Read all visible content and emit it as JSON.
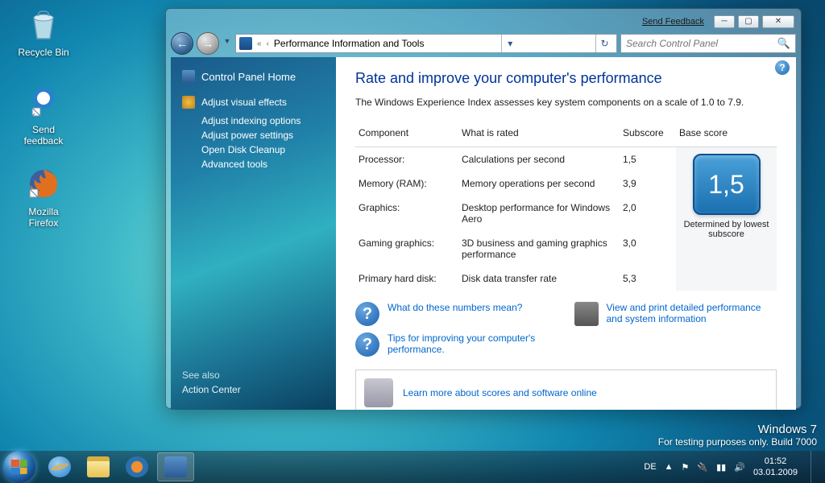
{
  "desktop": {
    "icons": [
      {
        "name": "recycle-bin",
        "label": "Recycle Bin"
      },
      {
        "name": "send-feedback",
        "label": "Send feedback"
      },
      {
        "name": "firefox",
        "label": "Mozilla Firefox"
      }
    ]
  },
  "window": {
    "send_feedback": "Send Feedback",
    "breadcrumb": {
      "chev1": "«",
      "chev2": "‹",
      "title": "Performance Information and Tools"
    },
    "search_placeholder": "Search Control Panel",
    "sidebar": {
      "home": "Control Panel Home",
      "adjust_visual": "Adjust visual effects",
      "subs": [
        "Adjust indexing options",
        "Adjust power settings",
        "Open Disk Cleanup",
        "Advanced tools"
      ],
      "see_also_hdr": "See also",
      "see_also_item": "Action Center"
    },
    "main": {
      "heading": "Rate and improve your computer's performance",
      "intro": "The Windows Experience Index assesses key system components on a scale of 1.0 to 7.9.",
      "cols": {
        "component": "Component",
        "rated": "What is rated",
        "sub": "Subscore",
        "base": "Base score"
      },
      "rows": [
        {
          "c": "Processor:",
          "r": "Calculations per second",
          "s": "1,5"
        },
        {
          "c": "Memory (RAM):",
          "r": "Memory operations per second",
          "s": "3,9"
        },
        {
          "c": "Graphics:",
          "r": "Desktop performance for Windows Aero",
          "s": "2,0"
        },
        {
          "c": "Gaming graphics:",
          "r": "3D business and gaming graphics performance",
          "s": "3,0"
        },
        {
          "c": "Primary hard disk:",
          "r": "Disk data transfer rate",
          "s": "5,3"
        }
      ],
      "base_score": "1,5",
      "base_caption": "Determined by lowest subscore",
      "link_numbers": "What do these numbers mean?",
      "link_tips": "Tips for improving your computer's performance.",
      "link_print": "View and print detailed performance and system information",
      "link_learn": "Learn more about scores and software online"
    }
  },
  "taskbar": {
    "lang": "DE",
    "time": "01:52",
    "date": "03.01.2009",
    "up": "▲"
  },
  "watermark": {
    "os": "Windows  7",
    "build": "For testing purposes only. Build 7000"
  }
}
